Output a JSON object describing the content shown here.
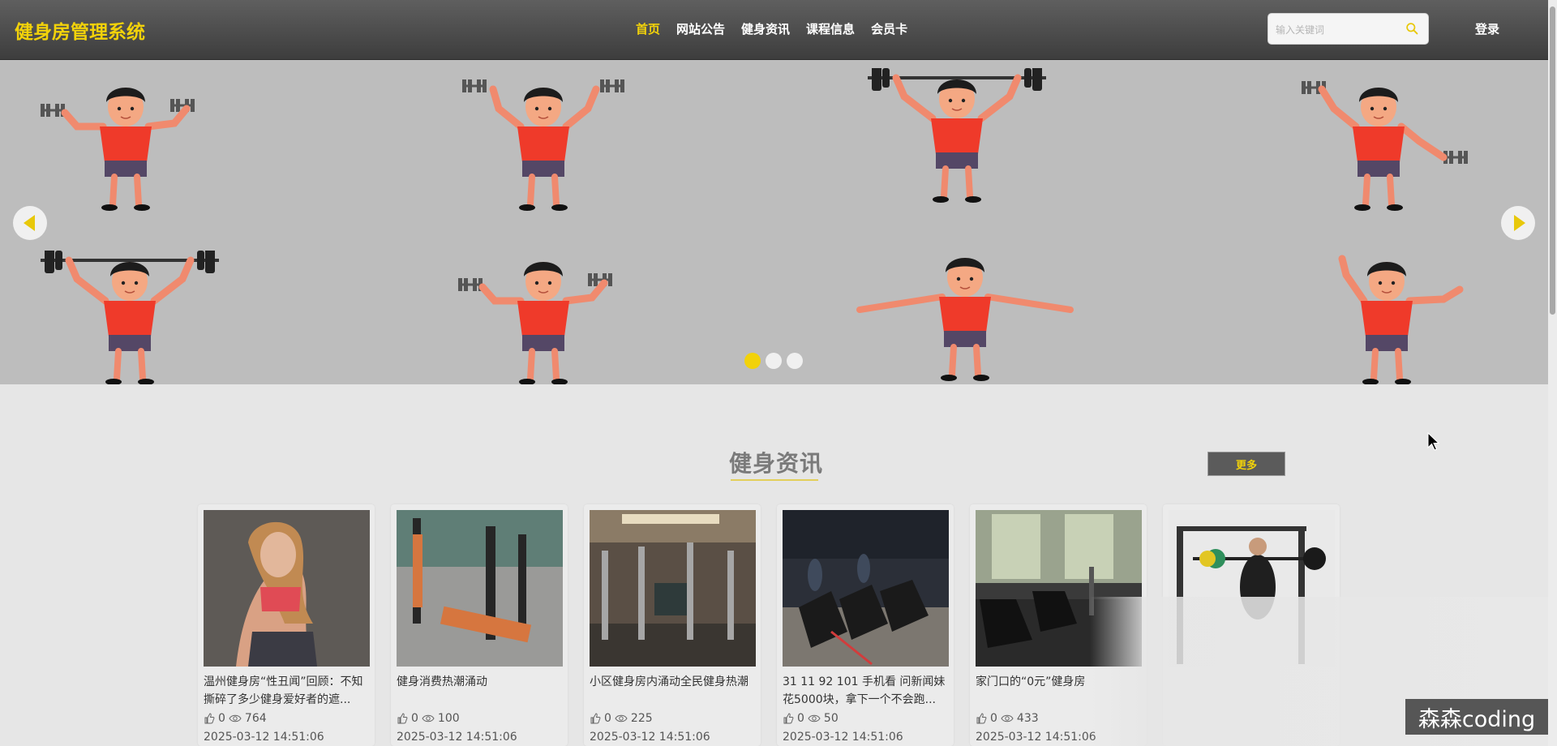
{
  "header": {
    "logo": "健身房管理系统",
    "nav": [
      "首页",
      "网站公告",
      "健身资讯",
      "课程信息",
      "会员卡"
    ],
    "active_index": 0,
    "search_placeholder": "输入关键词",
    "login_label": "登录"
  },
  "banner": {
    "slide_count": 3,
    "active_slide": 0,
    "prev_icon": "caret-left-icon",
    "next_icon": "caret-right-icon"
  },
  "section": {
    "title": "健身资讯",
    "more_label": "更多"
  },
  "articles": [
    {
      "title": "温州健身房“性丑闻”回顾：不知撕碎了多少健身爱好者的遮...",
      "likes": "0",
      "views": "764",
      "date": "2025-03-12 14:51:06"
    },
    {
      "title": "健身消费热潮涌动",
      "likes": "0",
      "views": "100",
      "date": "2025-03-12 14:51:06"
    },
    {
      "title": "小区健身房内涌动全民健身热潮",
      "likes": "0",
      "views": "225",
      "date": "2025-03-12 14:51:06"
    },
    {
      "title": "31 11 92 101 手机看 问新闻妹花5000块，拿下一个不会跑...",
      "likes": "0",
      "views": "50",
      "date": "2025-03-12 14:51:06"
    },
    {
      "title": "家门口的“0元”健身房",
      "likes": "0",
      "views": "433",
      "date": "2025-03-12 14:51:06"
    },
    {
      "title": "",
      "likes": "",
      "views": "",
      "date": ""
    }
  ],
  "watermark": "森森coding",
  "colors": {
    "accent": "#f2d20a",
    "header_bg": "#4a4a4a",
    "page_bg": "#e6e6e6",
    "banner_bg": "#bdbdbd",
    "shirt": "#ef3a2a",
    "shorts": "#544766"
  }
}
